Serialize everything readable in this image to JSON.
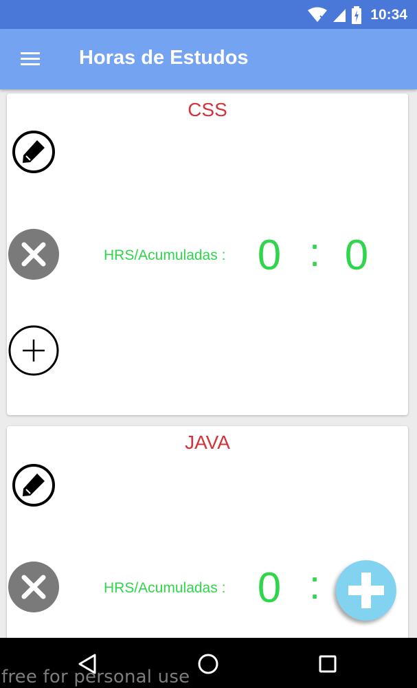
{
  "status_bar": {
    "time": "10:34",
    "icons": [
      "wifi-icon",
      "signal-icon",
      "battery-icon"
    ]
  },
  "app_bar": {
    "title": "Horas de Estudos",
    "menu_icon": "hamburger-menu-icon"
  },
  "cards": [
    {
      "title": "CSS",
      "hrs_label": "HRS/Acumuladas :",
      "hours": "0",
      "separator": ":",
      "minutes": "0"
    },
    {
      "title": "JAVA",
      "hrs_label": "HRS/Acumuladas :",
      "hours": "0",
      "separator": ":",
      "minutes": ""
    }
  ],
  "fab": {
    "icon": "add-icon"
  },
  "nav_bar": {
    "icons": [
      "back-icon",
      "home-icon",
      "recents-icon"
    ]
  },
  "watermark": "free for personal use",
  "colors": {
    "status_bar": "#4a78d8",
    "app_bar": "#74a3f1",
    "card_title": "#d3343b",
    "hours_text": "#2fd54a",
    "delete_button": "#7a7a7a",
    "fab": "#82d3ef"
  }
}
